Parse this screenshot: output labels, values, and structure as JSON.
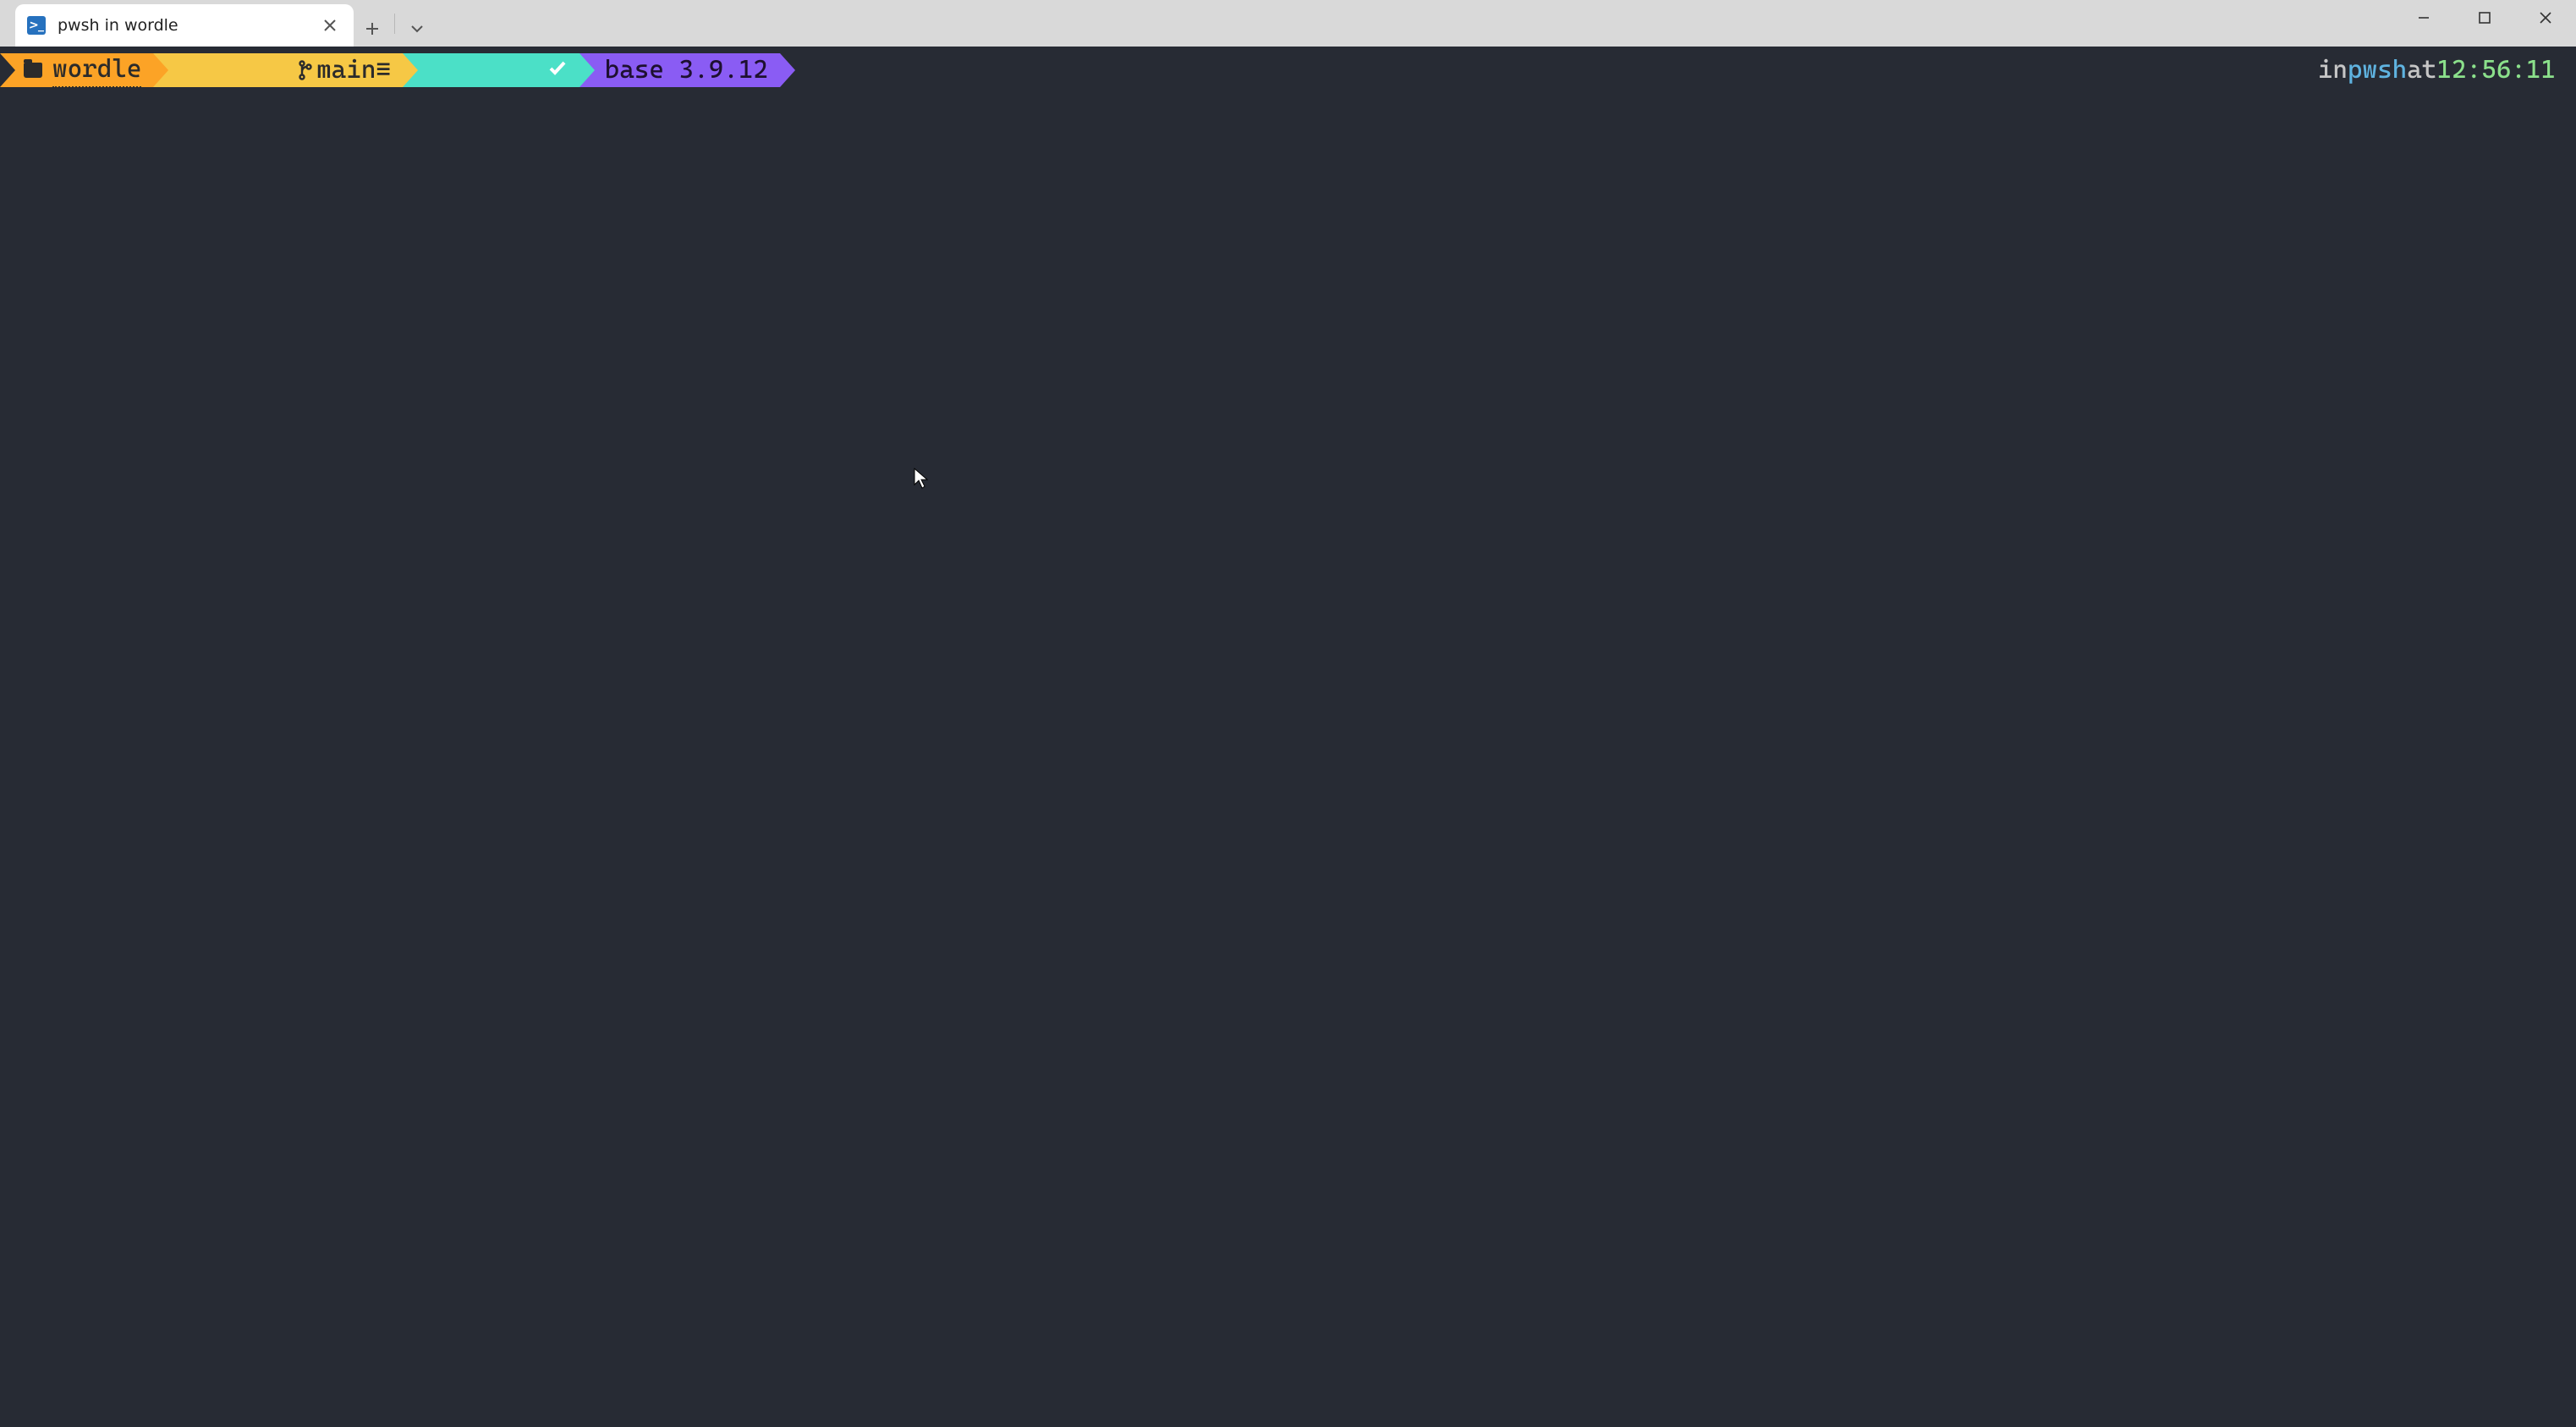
{
  "window": {
    "tab_title": "pwsh in wordle"
  },
  "prompt": {
    "segments": {
      "path": "wordle",
      "git_branch": "main",
      "git_status_suffix": "≡",
      "python_env": "base 3.9.12"
    },
    "right": {
      "prefix": "in ",
      "shell": "pwsh",
      "mid": " at ",
      "time": "12:56:11"
    }
  },
  "colors": {
    "terminal_bg": "#272b34",
    "seg_path_bg": "#fca326",
    "seg_git_bg": "#f6c845",
    "seg_ok_bg": "#4be0c7",
    "seg_py_bg": "#8a5cf4"
  }
}
